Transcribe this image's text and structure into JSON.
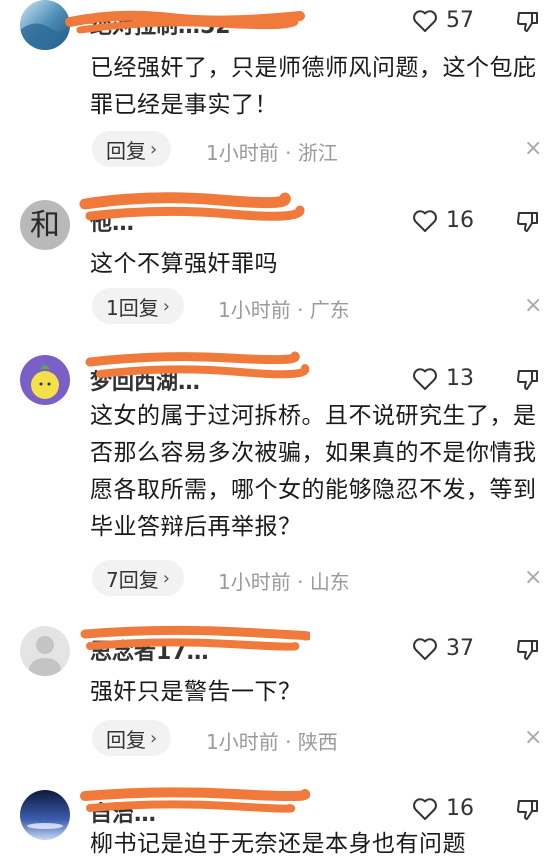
{
  "comments": [
    {
      "username": "绝对拉制…52",
      "likes": "57",
      "text": "已经强奸了，只是师德师风问题，这个包庇罪已经是事实了！",
      "reply_label": "回复",
      "time": "1小时前",
      "location": "浙江"
    },
    {
      "username": "他…",
      "likes": "16",
      "text": "这个不算强奸罪吗",
      "reply_label": "1回复",
      "time": "1小时前",
      "location": "广东"
    },
    {
      "username": "梦回西湖…",
      "likes": "13",
      "text": "这女的属于过河拆桥。且不说研究生了，是否那么容易多次被骗，如果真的不是你情我愿各取所需，哪个女的能够隐忍不发，等到毕业答辩后再举报？",
      "reply_label": "7回复",
      "time": "1小时前",
      "location": "山东"
    },
    {
      "username": "思念者17…",
      "likes": "37",
      "text": "强奸只是警告一下？",
      "reply_label": "回复",
      "time": "1小时前",
      "location": "陕西"
    },
    {
      "username": "自治…",
      "likes": "16",
      "text": "柳书记是迫于无奈还是本身也有问题",
      "reply_label": "",
      "time": "",
      "location": ""
    }
  ],
  "meta_separator": "·",
  "colors": {
    "redaction": "#f07a3c",
    "meta_text": "#9a9a9a",
    "reply_bg": "#f2f2f2"
  },
  "icons": {
    "like": "heart-outline-icon",
    "dislike": "thumbs-down-outline-icon",
    "reply_chevron": "chevron-right-icon",
    "dismiss": "close-icon"
  }
}
